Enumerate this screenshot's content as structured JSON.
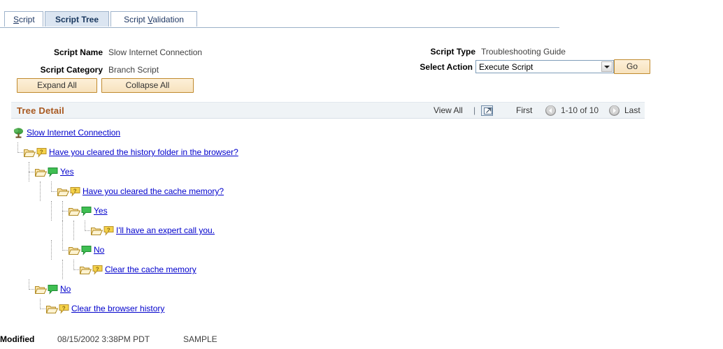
{
  "tabs": [
    {
      "id": "script",
      "label": "Script",
      "underline_index": 1,
      "active": false
    },
    {
      "id": "tree",
      "label": "Script Tree",
      "underline_index": -1,
      "active": true
    },
    {
      "id": "validation",
      "label": "Script Validation",
      "underline_index": 7,
      "active": false
    }
  ],
  "header": {
    "script_name_label": "Script Name",
    "script_name_value": "Slow Internet Connection",
    "script_category_label": "Script Category",
    "script_category_value": "Branch Script",
    "script_type_label": "Script Type",
    "script_type_value": "Troubleshooting Guide",
    "select_action_label": "Select Action",
    "select_action_value": "Execute Script",
    "go_button": "Go"
  },
  "actions": {
    "expand_all": "Expand All",
    "collapse_all": "Collapse All"
  },
  "grid": {
    "title": "Tree Detail",
    "view_all": "View All",
    "separator": "|",
    "view_all_icon": "new-window-icon",
    "first": "First",
    "prev_icon": "previous-arrow-icon",
    "page_range": "1-10 of 10",
    "next_icon": "next-arrow-icon",
    "last": "Last"
  },
  "tree": [
    {
      "level": 0,
      "connector": "none",
      "pipes": 0,
      "icon": "tree-icon",
      "bubble": "none",
      "label": "Slow Internet Connection"
    },
    {
      "level": 1,
      "connector": "ell",
      "pipes": 0,
      "icon": "folder-icon",
      "bubble": "question-bubble",
      "label": "Have you cleared the history folder in the browser?"
    },
    {
      "level": 2,
      "connector": "tee",
      "pipes": 0,
      "icon": "folder-icon",
      "bubble": "answer-bubble",
      "label": "Yes"
    },
    {
      "level": 3,
      "connector": "ell",
      "pipes": 1,
      "icon": "folder-icon",
      "bubble": "question-bubble",
      "label": "Have you cleared the cache memory?"
    },
    {
      "level": 4,
      "connector": "tee",
      "pipes": 1,
      "icon": "folder-icon",
      "bubble": "answer-bubble",
      "label": "Yes"
    },
    {
      "level": 5,
      "connector": "ell",
      "pipes": 2,
      "icon": "folder-icon",
      "bubble": "question-bubble",
      "label": "I'll have an expert call you."
    },
    {
      "level": 4,
      "connector": "ell",
      "pipes": 1,
      "icon": "folder-icon",
      "bubble": "answer-bubble",
      "label": "No"
    },
    {
      "level": 5,
      "connector": "ell",
      "pipes": 1,
      "icon": "folder-icon",
      "bubble": "question-bubble",
      "label": "Clear the cache memory"
    },
    {
      "level": 2,
      "connector": "ell",
      "pipes": 0,
      "icon": "folder-icon",
      "bubble": "answer-bubble",
      "label": "No"
    },
    {
      "level": 3,
      "connector": "ell",
      "pipes": 0,
      "icon": "folder-icon",
      "bubble": "question-bubble",
      "label": "Clear the browser history"
    }
  ],
  "footer": {
    "modified_label": "Modified",
    "modified_value": "08/15/2002  3:38PM PDT",
    "sample_value": "SAMPLE"
  }
}
